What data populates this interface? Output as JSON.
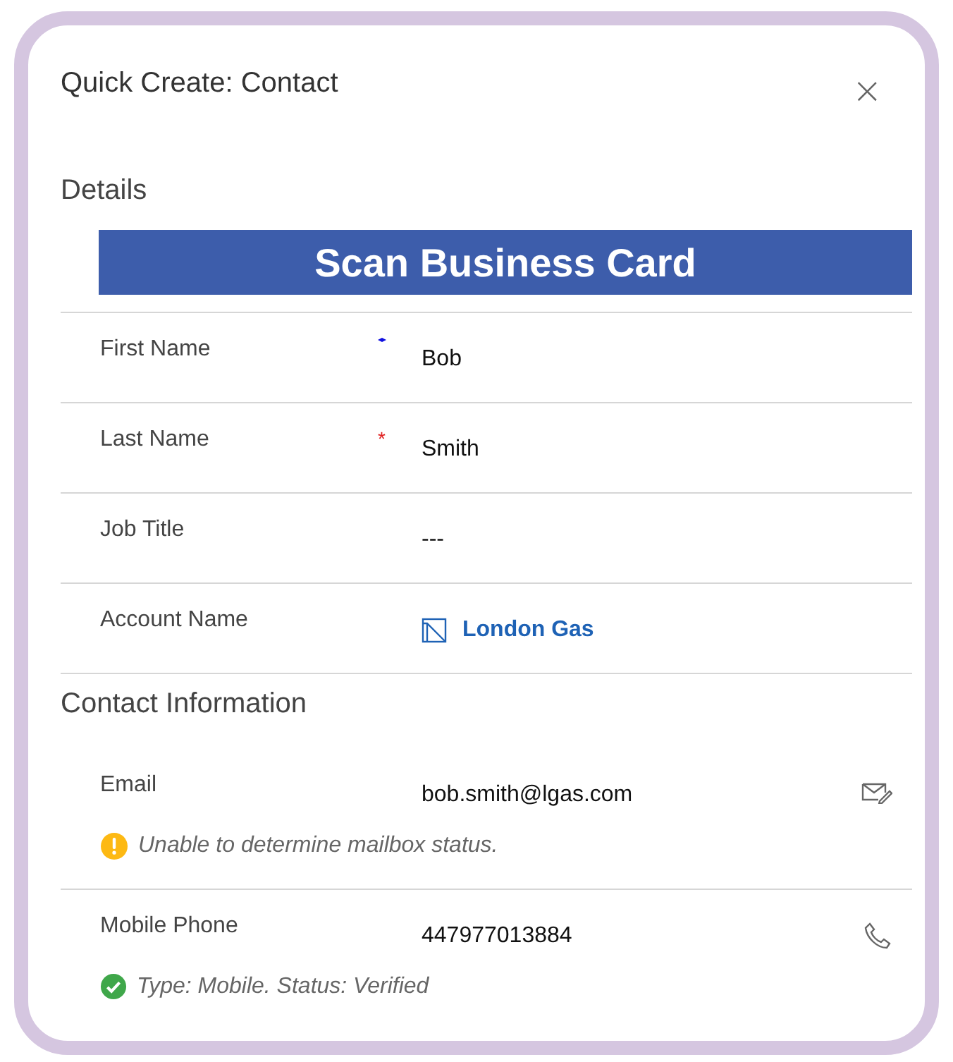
{
  "window": {
    "title": "Quick Create: Contact",
    "close": "×"
  },
  "sections": [
    {
      "title": "Details",
      "banner": "Scan Business Card",
      "fields": [
        {
          "label": "First Name",
          "recommended": true,
          "required": false,
          "value": "Bob",
          "kind": "text"
        },
        {
          "label": "Last Name",
          "recommended": false,
          "required": true,
          "mark": "*",
          "value": "Smith",
          "kind": "text"
        },
        {
          "label": "Job Title",
          "recommended": false,
          "required": false,
          "value": "---",
          "kind": "text"
        },
        {
          "label": "Account Name",
          "recommended": false,
          "required": false,
          "value": "London Gas",
          "kind": "lookup"
        }
      ]
    },
    {
      "title": "Contact Information",
      "fields": [
        {
          "label": "Email",
          "recommended": false,
          "required": false,
          "value": "bob.smith@lgas.com",
          "kind": "text",
          "action": {
            "kind": "email"
          },
          "notice": {
            "kind": "warning",
            "text": "Unable to determine mailbox status."
          }
        },
        {
          "label": "Mobile Phone",
          "recommended": false,
          "required": false,
          "value": "447977013884",
          "kind": "text",
          "action": {
            "kind": "call"
          },
          "notice": {
            "kind": "success",
            "text": "Type: Mobile. Status: Verified"
          }
        }
      ]
    }
  ]
}
